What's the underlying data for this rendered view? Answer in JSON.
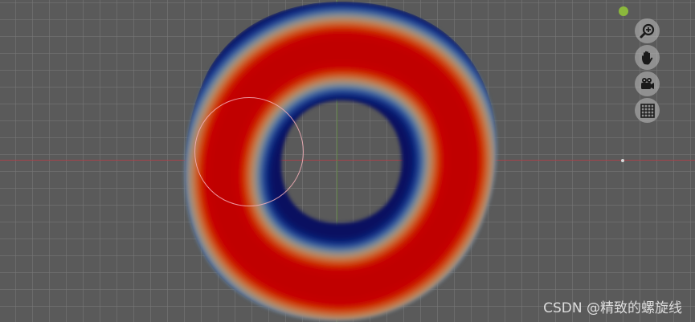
{
  "viewport": {
    "background_color": "#5a5a5a",
    "grid_color": "#787878",
    "x_axis_color": "#a3444b",
    "y_axis_color": "#5d8a3a"
  },
  "mesh": {
    "shape": "torus",
    "colormap": [
      "#0a1060",
      "#0030c0",
      "#0090e0",
      "#00c080",
      "#c8d000",
      "#e05000",
      "#cc0000",
      "#b80000"
    ]
  },
  "brush_cursor_color": "#f5afb9",
  "status_indicator_color": "#8bb83c",
  "navigation": {
    "buttons": [
      {
        "icon": "zoom-icon"
      },
      {
        "icon": "pan-hand-icon"
      },
      {
        "icon": "camera-icon"
      },
      {
        "icon": "grid-icon"
      }
    ]
  },
  "watermark": {
    "text": "CSDN @精致的螺旋线"
  }
}
